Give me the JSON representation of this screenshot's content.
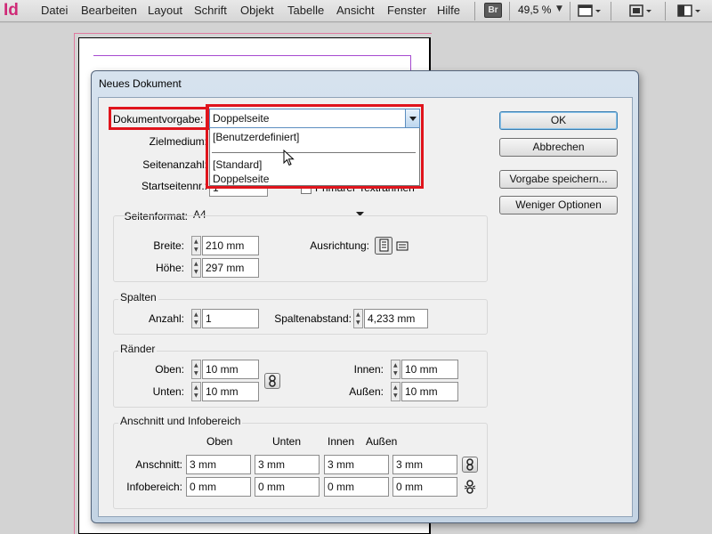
{
  "app": {
    "logo": "Id",
    "menus": [
      "Datei",
      "Bearbeiten",
      "Layout",
      "Schrift",
      "Objekt",
      "Tabelle",
      "Ansicht",
      "Fenster",
      "Hilfe"
    ],
    "bridge_badge": "Br",
    "zoom": "49,5 %",
    "toolbar_icons": [
      "screen-mode-icon",
      "view-options-icon",
      "arrange-documents-icon"
    ]
  },
  "dialog": {
    "title": "Neues Dokument",
    "preset_label": "Dokumentvorgabe:",
    "preset_value": "Doppelseite",
    "preset_options": [
      "[Benutzerdefiniert]",
      "[Standard]",
      "Doppelseite"
    ],
    "intent_label": "Zielmedium:",
    "pages_label": "Seitenanzahl:",
    "start_page_label": "Startseitennr.:",
    "start_page_value": "1",
    "primary_frame_label": "Primärer Textrahmen",
    "page_size_label": "Seitenformat:",
    "page_size_value": "A4",
    "width_label": "Breite:",
    "width_value": "210 mm",
    "height_label": "Höhe:",
    "height_value": "297 mm",
    "orientation_label": "Ausrichtung:",
    "columns": {
      "group_title": "Spalten",
      "count_label": "Anzahl:",
      "count_value": "1",
      "gutter_label": "Spaltenabstand:",
      "gutter_value": "4,233 mm"
    },
    "margins": {
      "group_title": "Ränder",
      "top_label": "Oben:",
      "top_value": "10 mm",
      "bottom_label": "Unten:",
      "bottom_value": "10 mm",
      "inside_label": "Innen:",
      "inside_value": "10 mm",
      "outside_label": "Außen:",
      "outside_value": "10 mm"
    },
    "bleed_slug": {
      "group_title": "Anschnitt und Infobereich",
      "col_headers": [
        "Oben",
        "Unten",
        "Innen",
        "Außen"
      ],
      "bleed_label": "Anschnitt:",
      "bleed_values": [
        "3 mm",
        "3 mm",
        "3 mm",
        "3 mm"
      ],
      "slug_label": "Infobereich:",
      "slug_values": [
        "0 mm",
        "0 mm",
        "0 mm",
        "0 mm"
      ]
    },
    "buttons": {
      "ok": "OK",
      "cancel": "Abbrechen",
      "save_preset": "Vorgabe speichern...",
      "fewer_options": "Weniger Optionen"
    }
  },
  "colors": {
    "highlight": "#e0141c",
    "logo": "#cf2a77",
    "margin_guide": "#a64ad0"
  }
}
